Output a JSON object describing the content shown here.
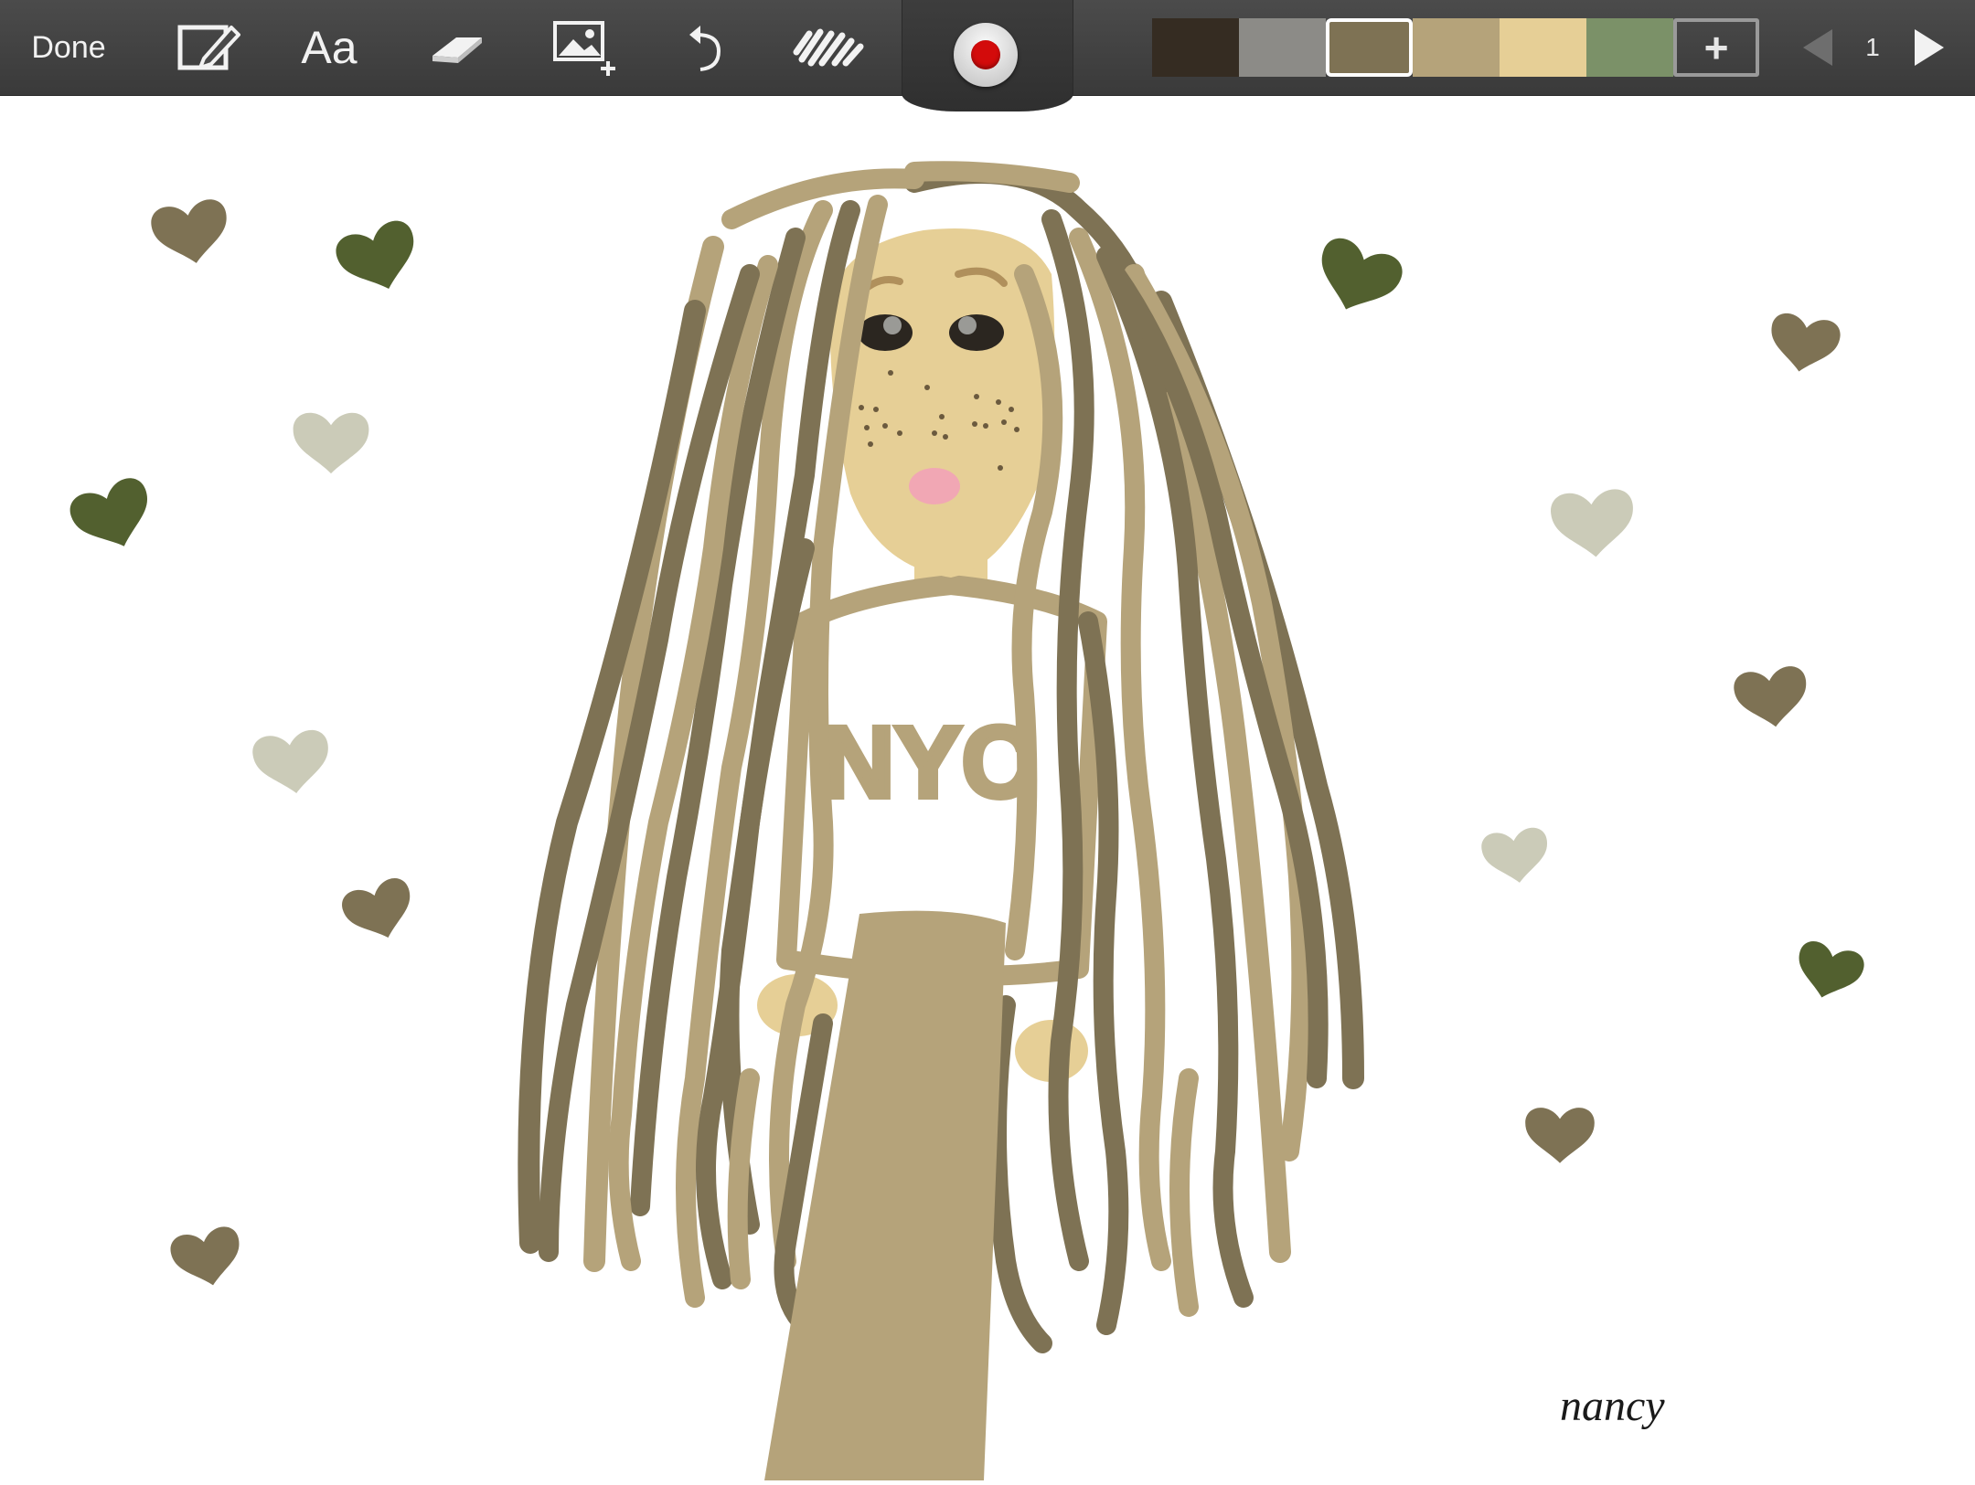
{
  "toolbar": {
    "done_label": "Done",
    "font_label": "Aa",
    "page_number": "1",
    "icons": [
      "edit-pen-icon",
      "font-icon",
      "eraser-icon",
      "insert-image-icon",
      "undo-icon",
      "brush-icon",
      "record-icon",
      "add-color-icon",
      "prev-page-icon",
      "next-page-icon"
    ],
    "palette": [
      {
        "color": "#352c22",
        "selected": false
      },
      {
        "color": "#8c8b87",
        "selected": false
      },
      {
        "color": "#7e7254",
        "selected": true
      },
      {
        "color": "#b5a37a",
        "selected": false
      },
      {
        "color": "#e6cf96",
        "selected": false
      },
      {
        "color": "#7b9168",
        "selected": false
      }
    ],
    "add_color_label": "+"
  },
  "drawing": {
    "colors": {
      "hair_dark": "#7e7254",
      "hair_light": "#b5a37a",
      "skin": "#e6cf96",
      "heart_green": "#52602f",
      "heart_brown": "#7e7254",
      "heart_grey": "#cbcbb8",
      "blush": "#f1a7b4"
    },
    "shirt_text": "NYC",
    "signature": "nancy"
  }
}
